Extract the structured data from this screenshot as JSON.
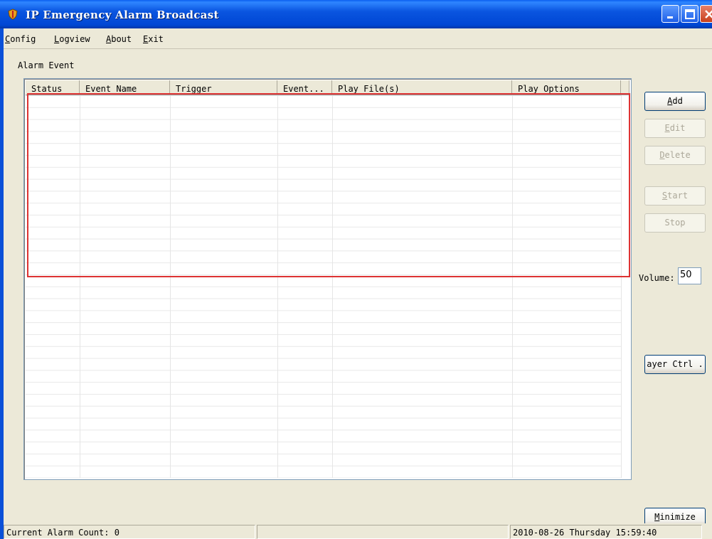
{
  "window": {
    "title": "IP Emergency Alarm Broadcast",
    "titlebar_color": "#0a55e0"
  },
  "menu": [
    "Config",
    "Logview",
    "About",
    "Exit"
  ],
  "group_label": "Alarm Event",
  "table": {
    "columns": [
      "Status",
      "Event Name",
      "Trigger",
      "Event...",
      "Play File(s)",
      "Play Options"
    ],
    "rows": []
  },
  "buttons": {
    "add": "Add",
    "edit": "Edit",
    "delete": "Delete",
    "start": "Start",
    "stop": "Stop",
    "player_ctrl": "ayer Ctrl .",
    "minimize": "Minimize"
  },
  "volume": {
    "label": "Volume:",
    "value": "50"
  },
  "status": {
    "alarm_count": "Current Alarm Count: 0",
    "datetime": "2010-08-26 Thursday 15:59:40"
  },
  "highlight_color": "#dd3333"
}
